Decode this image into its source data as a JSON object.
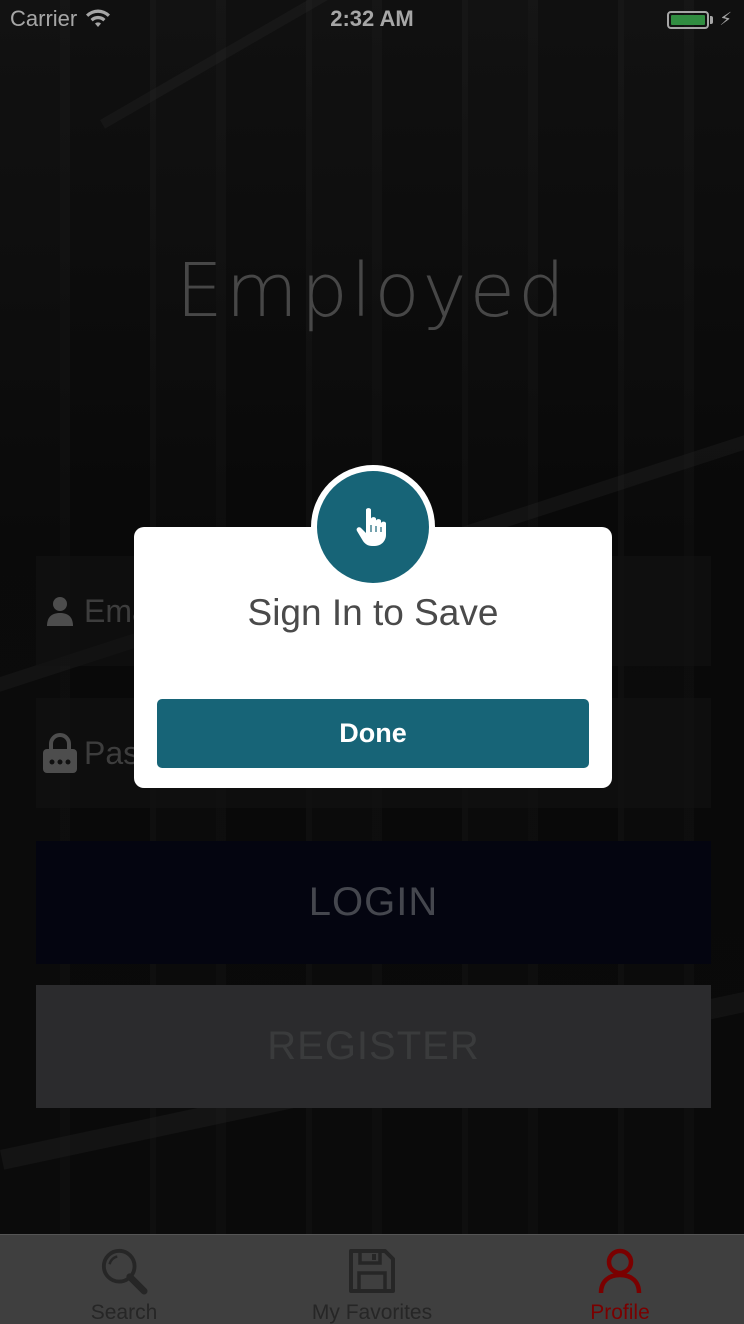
{
  "status_bar": {
    "carrier": "Carrier",
    "time": "2:32 AM",
    "battery_level": 1.0
  },
  "app": {
    "title": "Employed"
  },
  "form": {
    "email_placeholder": "Email",
    "password_placeholder": "Password",
    "login_label": "LOGIN",
    "register_label": "REGISTER"
  },
  "modal": {
    "icon": "pointer-hand-icon",
    "title": "Sign In to Save",
    "done_label": "Done",
    "accent_color": "#176477"
  },
  "tabs": [
    {
      "label": "Search",
      "icon": "search-icon",
      "active": false
    },
    {
      "label": "My Favorites",
      "icon": "save-icon",
      "active": false
    },
    {
      "label": "Profile",
      "icon": "user-icon",
      "active": true
    }
  ],
  "colors": {
    "active_tab": "#7a0000",
    "login_button": "#07091a",
    "register_button": "#424345"
  }
}
